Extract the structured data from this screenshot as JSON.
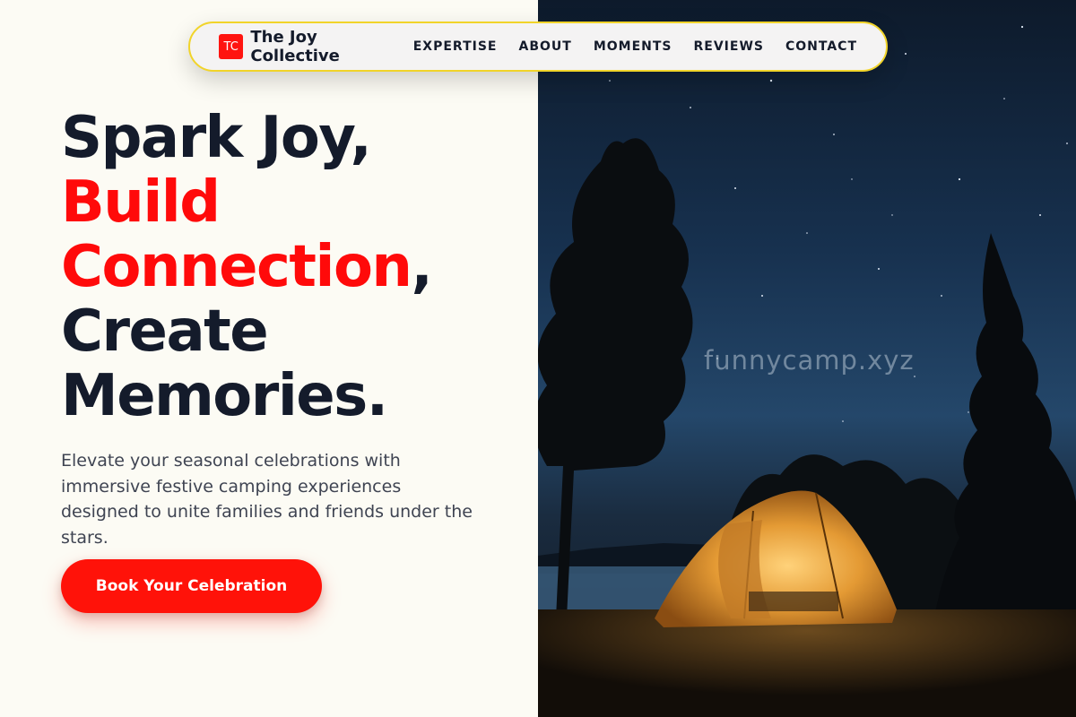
{
  "nav": {
    "logo_mark": "TC",
    "brand": "The Joy Collective",
    "links": [
      "EXPERTISE",
      "ABOUT",
      "MOMENTS",
      "REVIEWS",
      "CONTACT"
    ]
  },
  "hero": {
    "line1": "Spark Joy,",
    "line2": "Build",
    "line3_accent": "Connection",
    "line3_suffix": ",",
    "line4": "Create",
    "line5": "Memories.",
    "description": "Elevate your seasonal celebrations with immersive festive camping experiences designed to unite families and friends under the stars.",
    "cta_label": "Book Your Celebration"
  },
  "image": {
    "watermark": "funnycamp.xyz"
  },
  "colors": {
    "accent_red": "#ff1209",
    "nav_border_yellow": "#f1d42a",
    "text_dark": "#141b2b",
    "background_cream": "#fcfbf4"
  }
}
